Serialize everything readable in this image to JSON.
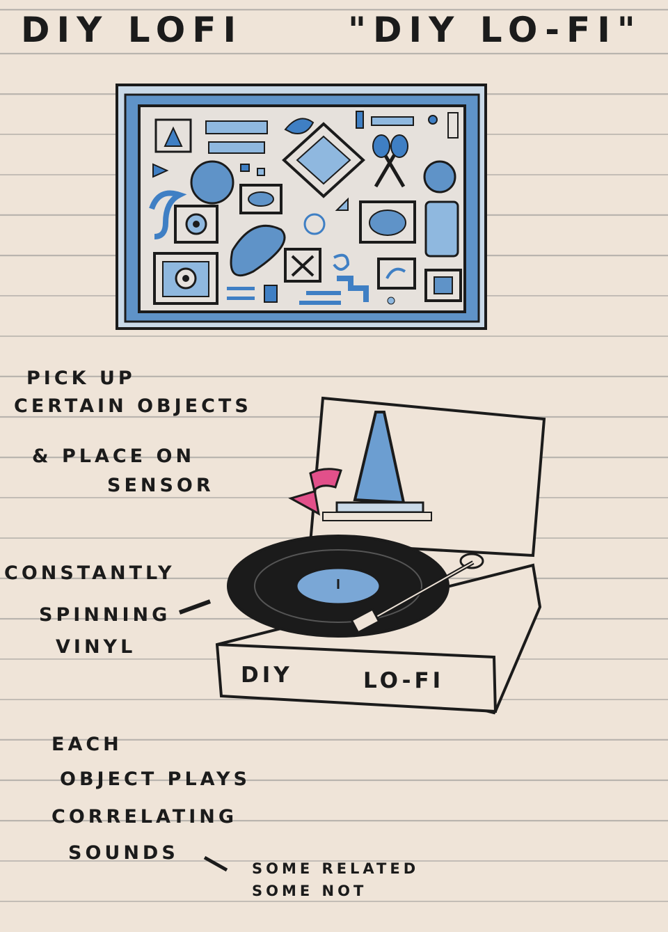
{
  "titles": {
    "left": "DIY LOFI",
    "right": "\"DIY LO-FI\""
  },
  "notes": {
    "pick": [
      "PICK UP",
      "CERTAIN OBJECTS",
      "& PLACE ON",
      "SENSOR"
    ],
    "spin": [
      "CONSTANTLY",
      "SPINNING",
      "VINYL"
    ],
    "each": [
      "EACH",
      "OBJECT PLAYS",
      "CORRELATING",
      "SOUNDS"
    ],
    "related": [
      "SOME RELATED",
      "SOME NOT"
    ]
  },
  "turntable": {
    "left_label": "DIY",
    "right_label": "LO-FI"
  },
  "colors": {
    "paper": "#efe4d8",
    "ink": "#1b1b1b",
    "blue": "#3f7fc4",
    "light_blue": "#8fb8df",
    "pink": "#e2508a"
  }
}
